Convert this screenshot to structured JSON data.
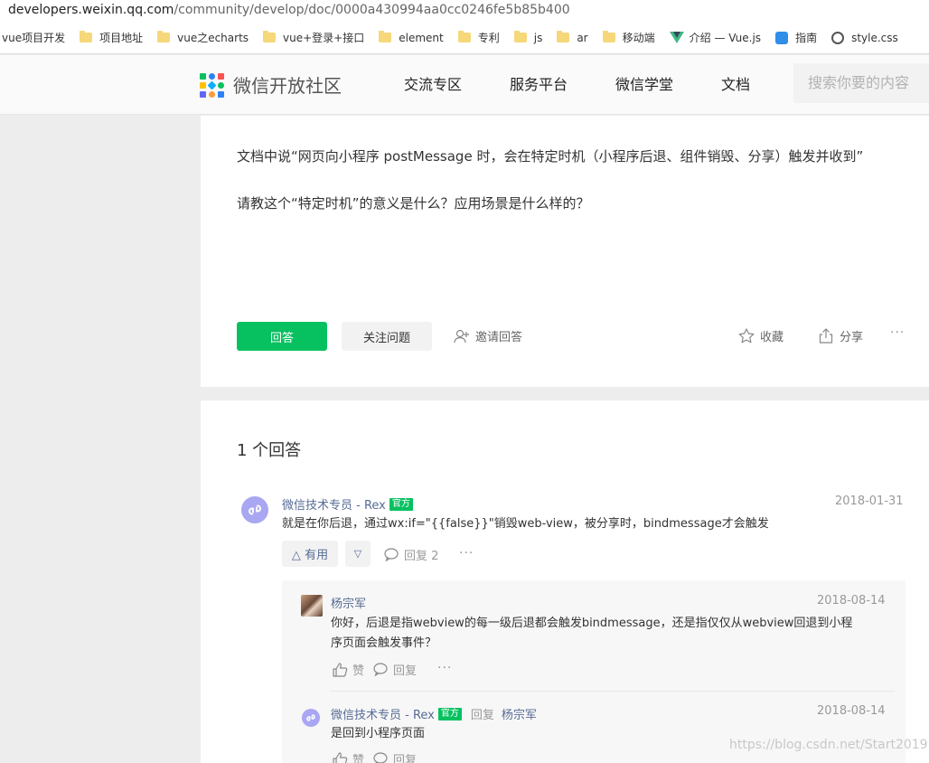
{
  "browser": {
    "url_host": "developers.weixin.qq.com",
    "url_path": "/community/develop/doc/0000a430994aa0cc0246fe5b85b400"
  },
  "bookmarks": [
    {
      "label": "vue项目开发",
      "icon": "none"
    },
    {
      "label": "项目地址",
      "icon": "folder-icon"
    },
    {
      "label": "vue之echarts",
      "icon": "folder-icon"
    },
    {
      "label": "vue+登录+接口",
      "icon": "folder-icon"
    },
    {
      "label": "element",
      "icon": "folder-icon"
    },
    {
      "label": "专利",
      "icon": "folder-icon"
    },
    {
      "label": "js",
      "icon": "folder-icon"
    },
    {
      "label": "ar",
      "icon": "folder-icon"
    },
    {
      "label": "移动端",
      "icon": "folder-icon"
    },
    {
      "label": "介绍 — Vue.js",
      "icon": "vue-icon"
    },
    {
      "label": "指南",
      "icon": "guide-icon"
    },
    {
      "label": "style.css",
      "icon": "globe-icon"
    }
  ],
  "header": {
    "site_title": "微信开放社区",
    "nav": [
      "交流专区",
      "服务平台",
      "微信学堂",
      "文档"
    ],
    "search_placeholder": "搜索你要的内容"
  },
  "question": {
    "line1": "文档中说“网页向小程序 postMessage 时，会在特定时机（小程序后退、组件销毁、分享）触发并收到”",
    "line2": "请教这个“特定时机”的意义是什么？应用场景是什么样的？",
    "answer_button": "回答",
    "follow_button": "关注问题",
    "invite_label": "邀请回答",
    "favorite_label": "收藏",
    "share_label": "分享",
    "more_label": "···"
  },
  "answers": {
    "count_label": "1 个回答",
    "items": [
      {
        "author": "微信技术专员 - Rex",
        "badge": "官方",
        "date": "2018-01-31",
        "content": "就是在你后退，通过wx:if=\"{{false}}\"销毁web-view，被分享时，bindmessage才会触发",
        "useful_label": "有用",
        "reply_label": "回复 2",
        "more_label": "···",
        "replies": [
          {
            "author": "杨宗军",
            "date": "2018-08-14",
            "content_line1": "你好，后退是指webview的每一级后退都会触发bindmessage，还是指仅仅从webview回退到小程",
            "content_line2": "序页面会触发事件？",
            "like_label": "赞",
            "reply_label": "回复",
            "more_label": "···"
          },
          {
            "author": "微信技术专员 - Rex",
            "badge": "官方",
            "reply_word": "回复",
            "reply_to": "杨宗军",
            "date": "2018-08-14",
            "content": "是回到小程序页面",
            "like_label": "赞",
            "reply_label": "回复"
          }
        ]
      }
    ]
  },
  "watermark": "https://blog.csdn.net/Start2019",
  "colors": {
    "brand_green": "#07c160",
    "link_blue": "#576b95",
    "avatar_purple": "#a9a7f2"
  }
}
